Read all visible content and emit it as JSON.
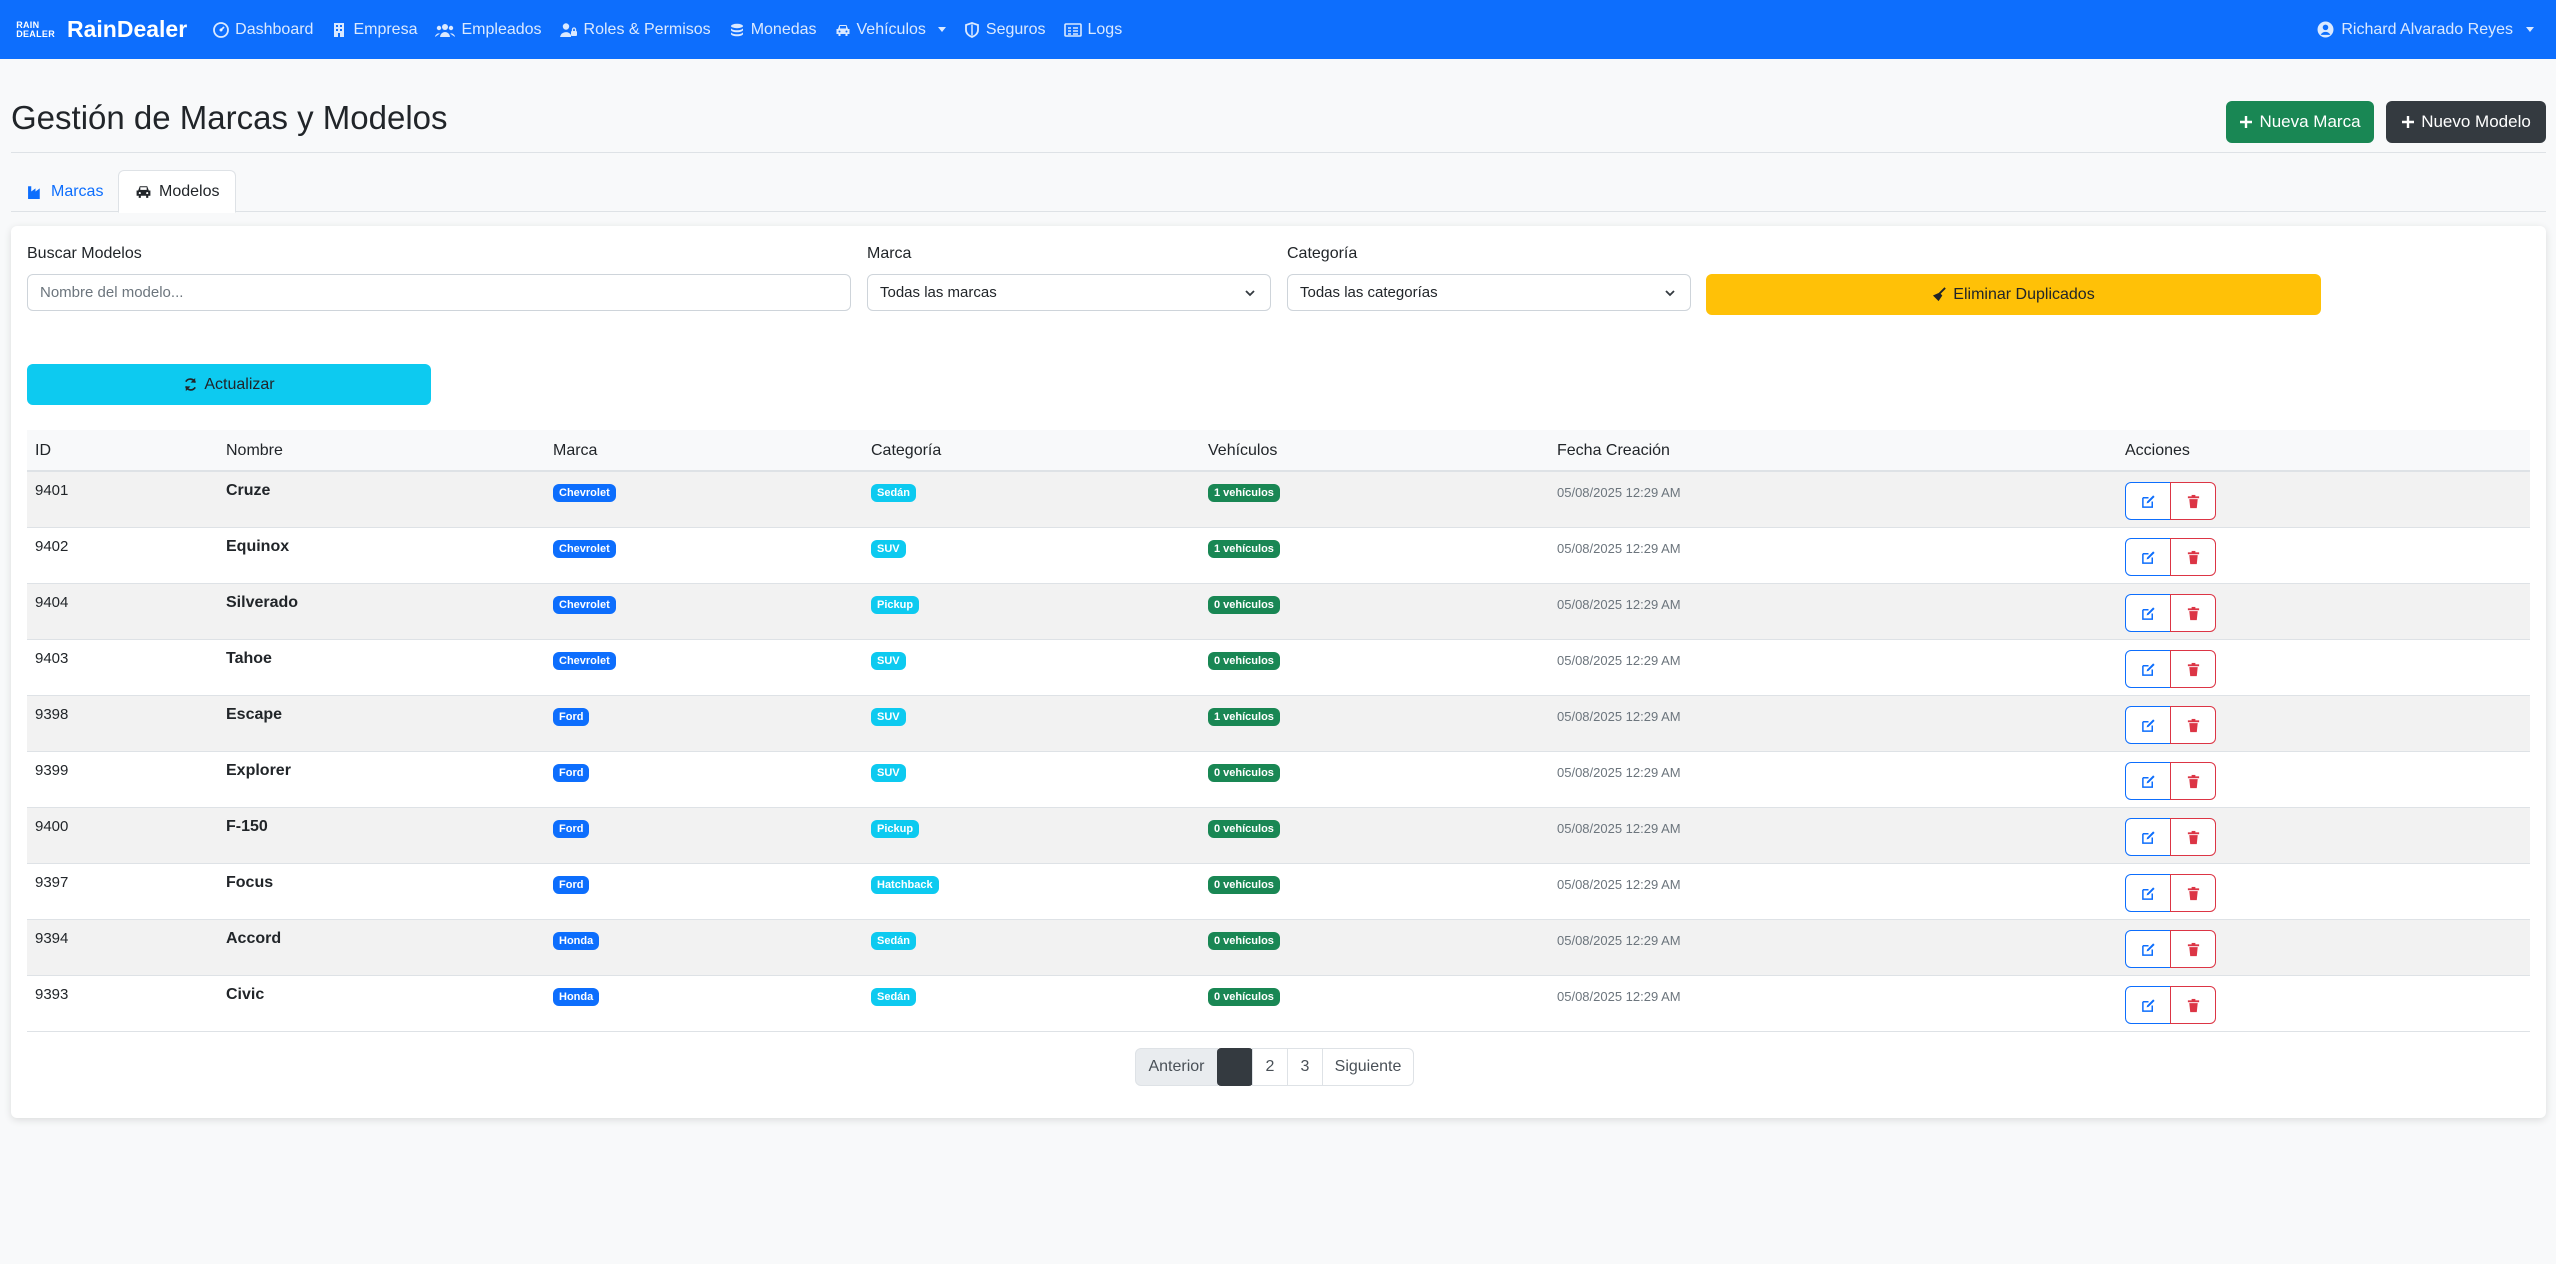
{
  "navbar": {
    "logo_text_top": "RAIN",
    "logo_text_bottom": "DEALER",
    "brand": "RainDealer",
    "items": [
      {
        "label": "Dashboard",
        "icon": "dashboard-icon"
      },
      {
        "label": "Empresa",
        "icon": "building-icon"
      },
      {
        "label": "Empleados",
        "icon": "users-icon"
      },
      {
        "label": "Roles & Permisos",
        "icon": "user-lock-icon"
      },
      {
        "label": "Monedas",
        "icon": "coins-icon"
      },
      {
        "label": "Vehículos",
        "icon": "car-icon",
        "dropdown": true
      },
      {
        "label": "Seguros",
        "icon": "shield-icon"
      },
      {
        "label": "Logs",
        "icon": "list-icon"
      }
    ],
    "user": "Richard Alvarado Reyes"
  },
  "header": {
    "title": "Gestión de Marcas y Modelos",
    "new_brand_label": "Nueva Marca",
    "new_model_label": "Nuevo Modelo"
  },
  "tabs": {
    "marcas": "Marcas",
    "modelos": "Modelos",
    "active": "modelos"
  },
  "filters": {
    "search_label": "Buscar Modelos",
    "search_placeholder": "Nombre del modelo...",
    "brand_label": "Marca",
    "brand_selected": "Todas las marcas",
    "category_label": "Categoría",
    "category_selected": "Todas las categorías",
    "dedupe_label": "Eliminar Duplicados",
    "refresh_label": "Actualizar"
  },
  "table": {
    "headers": {
      "id": "ID",
      "name": "Nombre",
      "brand": "Marca",
      "category": "Categoría",
      "vehicles": "Vehículos",
      "created": "Fecha Creación",
      "actions": "Acciones"
    },
    "rows": [
      {
        "id": "9401",
        "name": "Cruze",
        "brand": "Chevrolet",
        "category": "Sedán",
        "vehicles": "1 vehículos",
        "created": "05/08/2025 12:29 AM"
      },
      {
        "id": "9402",
        "name": "Equinox",
        "brand": "Chevrolet",
        "category": "SUV",
        "vehicles": "1 vehículos",
        "created": "05/08/2025 12:29 AM"
      },
      {
        "id": "9404",
        "name": "Silverado",
        "brand": "Chevrolet",
        "category": "Pickup",
        "vehicles": "0 vehículos",
        "created": "05/08/2025 12:29 AM"
      },
      {
        "id": "9403",
        "name": "Tahoe",
        "brand": "Chevrolet",
        "category": "SUV",
        "vehicles": "0 vehículos",
        "created": "05/08/2025 12:29 AM"
      },
      {
        "id": "9398",
        "name": "Escape",
        "brand": "Ford",
        "category": "SUV",
        "vehicles": "1 vehículos",
        "created": "05/08/2025 12:29 AM"
      },
      {
        "id": "9399",
        "name": "Explorer",
        "brand": "Ford",
        "category": "SUV",
        "vehicles": "0 vehículos",
        "created": "05/08/2025 12:29 AM"
      },
      {
        "id": "9400",
        "name": "F-150",
        "brand": "Ford",
        "category": "Pickup",
        "vehicles": "0 vehículos",
        "created": "05/08/2025 12:29 AM"
      },
      {
        "id": "9397",
        "name": "Focus",
        "brand": "Ford",
        "category": "Hatchback",
        "vehicles": "0 vehículos",
        "created": "05/08/2025 12:29 AM"
      },
      {
        "id": "9394",
        "name": "Accord",
        "brand": "Honda",
        "category": "Sedán",
        "vehicles": "0 vehículos",
        "created": "05/08/2025 12:29 AM"
      },
      {
        "id": "9393",
        "name": "Civic",
        "brand": "Honda",
        "category": "Sedán",
        "vehicles": "0 vehículos",
        "created": "05/08/2025 12:29 AM"
      }
    ]
  },
  "pagination": {
    "prev": "Anterior",
    "pages": [
      "",
      "2",
      "3"
    ],
    "current_page_index": 0,
    "next": "Siguiente"
  },
  "colors": {
    "primary": "#0d6efd",
    "success": "#198754",
    "dark": "#343a40",
    "warning": "#ffc107",
    "info": "#0dcaf0",
    "danger": "#dc3545"
  }
}
